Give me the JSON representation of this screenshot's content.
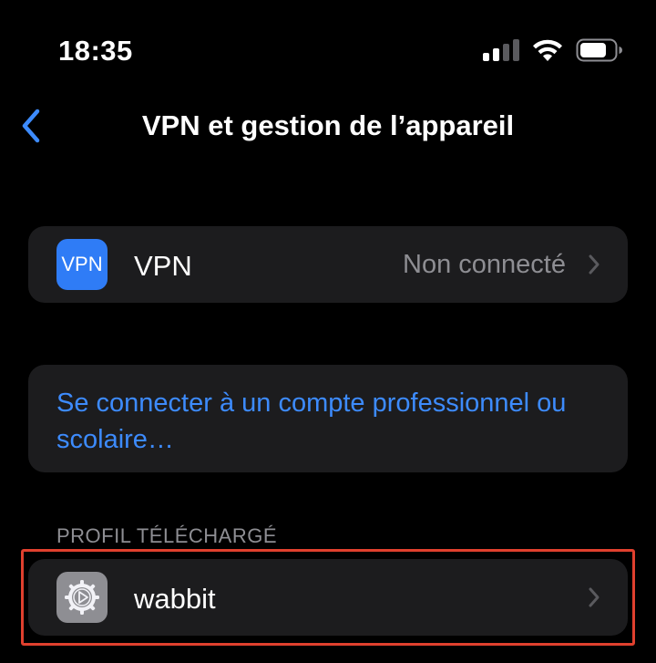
{
  "status_bar": {
    "time": "18:35"
  },
  "nav": {
    "title": "VPN et gestion de l’appareil"
  },
  "vpn_row": {
    "badge_text": "VPN",
    "label": "VPN",
    "status": "Non connecté"
  },
  "account_row": {
    "link_text": "Se connecter à un compte professionnel ou scolaire…"
  },
  "profile_section": {
    "header": "PROFIL TÉLÉCHARGÉ",
    "items": [
      {
        "label": "wabbit"
      }
    ]
  },
  "colors": {
    "background": "#000000",
    "card": "#1c1c1e",
    "accent_blue": "#3d8bfd",
    "vpn_badge": "#2f7cf6",
    "secondary_text": "#8e8e93",
    "highlight": "#e0402e"
  }
}
